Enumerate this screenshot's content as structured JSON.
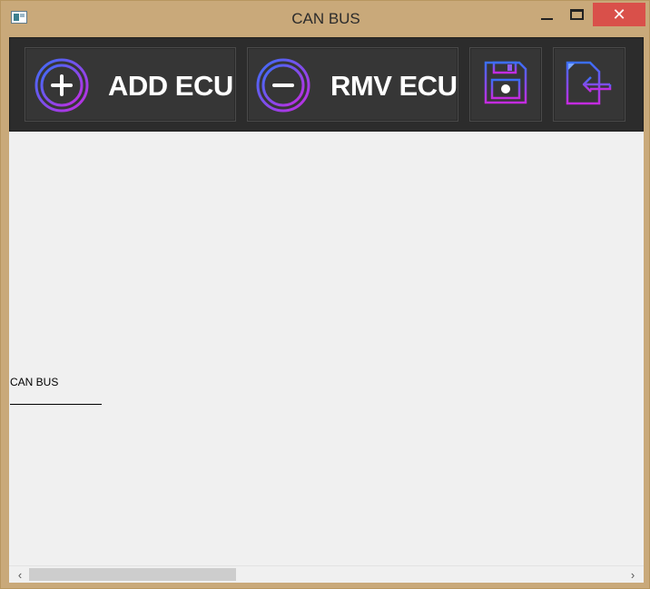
{
  "window": {
    "title": "CAN BUS",
    "close_glyph": "✕"
  },
  "toolbar": {
    "add_label": "ADD ECU",
    "rmv_label": "RMV ECU",
    "add_icon": "plus-circle-icon",
    "rmv_icon": "minus-circle-icon",
    "save_icon": "floppy-disk-icon",
    "load_icon": "file-import-icon"
  },
  "canvas": {
    "bus_label": "CAN BUS"
  },
  "scrollbar": {
    "left_glyph": "‹",
    "right_glyph": "›"
  },
  "colors": {
    "accent_blue": "#3a6ff7",
    "accent_purple": "#c52be0",
    "toolbar_bg": "#2c2c2c",
    "close_red": "#d9504a"
  }
}
